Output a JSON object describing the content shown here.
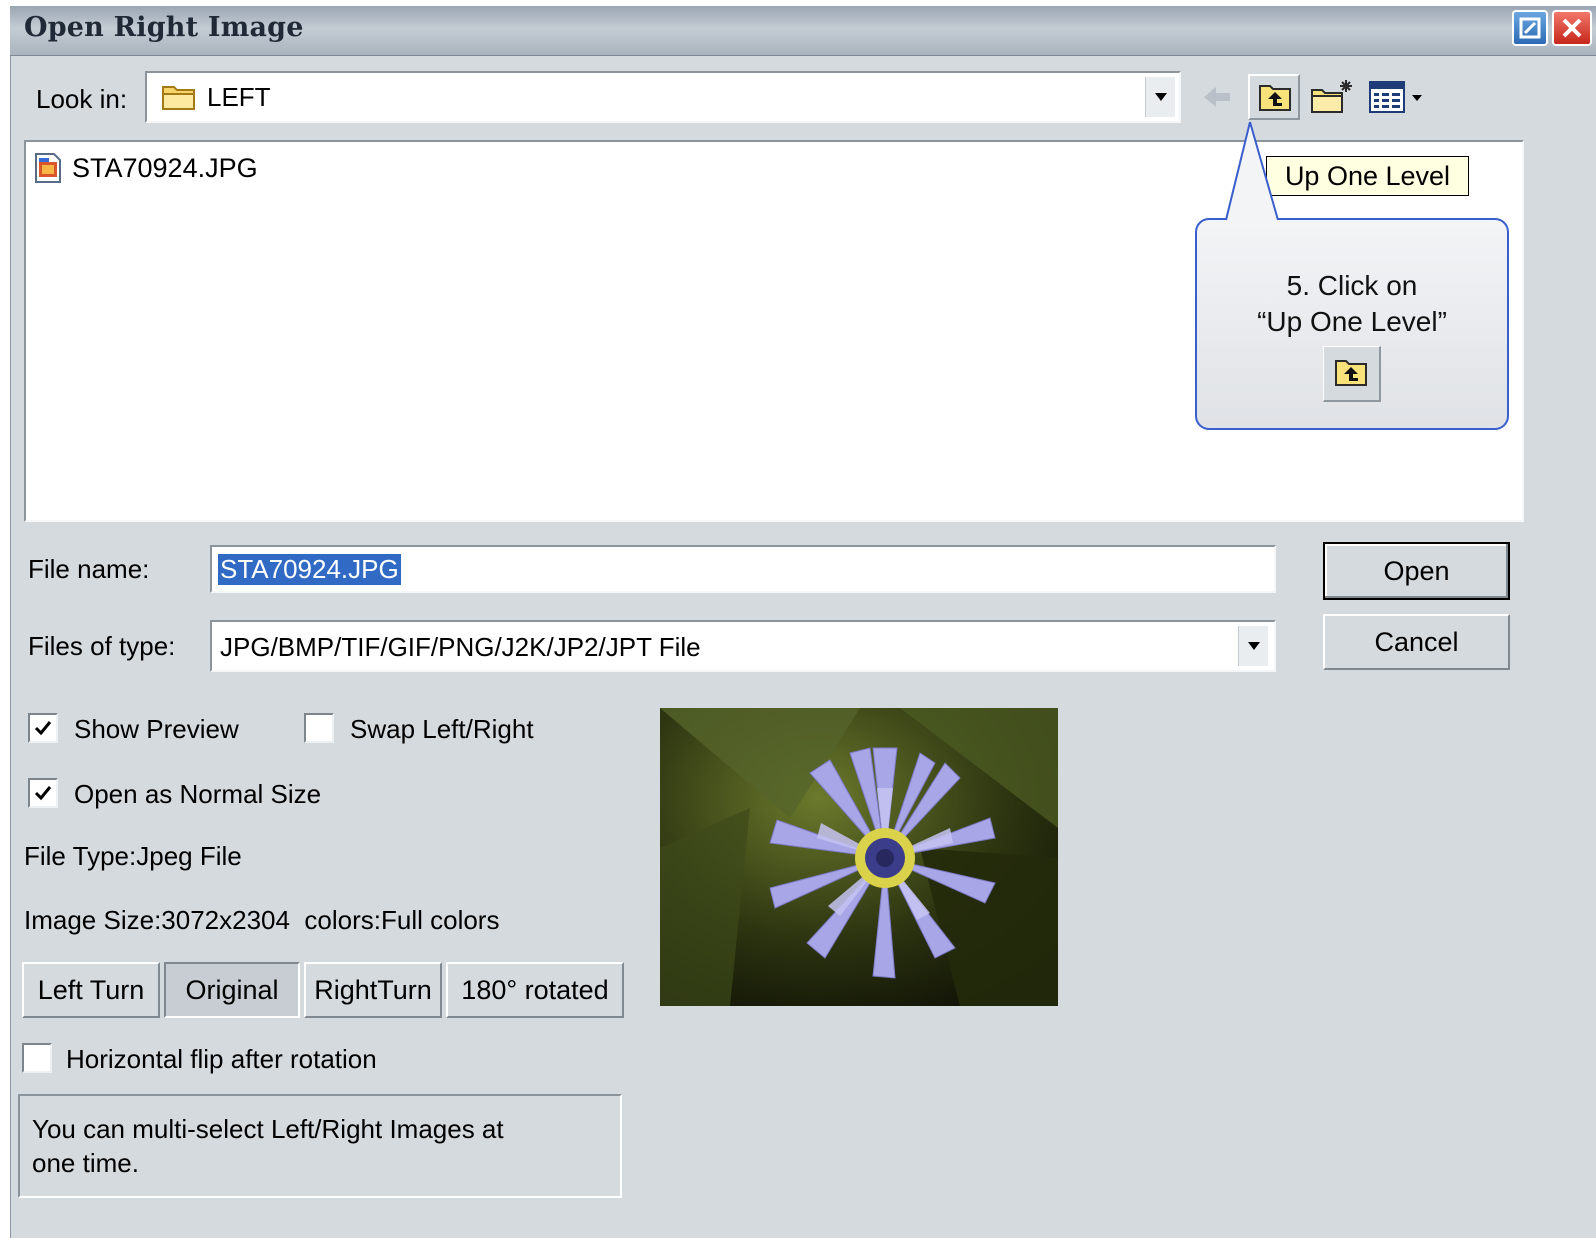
{
  "window": {
    "title": "Open Right Image"
  },
  "lookin": {
    "label": "Look in:",
    "value": "LEFT"
  },
  "toolbar": {
    "back": "back-icon",
    "up": "up-one-level-icon",
    "new_folder": "new-folder-icon",
    "view_menu": "view-menu-icon"
  },
  "tooltip": {
    "text": "Up One Level"
  },
  "callout": {
    "line1": "5. Click on",
    "line2": "“Up One Level”"
  },
  "files": [
    {
      "name": "STA70924.JPG",
      "icon": "jpg-file-icon"
    }
  ],
  "filename": {
    "label": "File name:",
    "value": "STA70924.JPG"
  },
  "filetype": {
    "label": "Files of type:",
    "value": "JPG/BMP/TIF/GIF/PNG/J2K/JP2/JPT File"
  },
  "buttons": {
    "open": "Open",
    "cancel": "Cancel"
  },
  "options": {
    "show_preview": {
      "label": "Show Preview",
      "checked": true
    },
    "swap": {
      "label": "Swap Left/Right",
      "checked": false
    },
    "normal_size": {
      "label": "Open as Normal Size",
      "checked": true
    },
    "hflip": {
      "label": "Horizontal flip after rotation",
      "checked": false
    }
  },
  "info": {
    "file_type": "File Type:Jpeg File",
    "image_size": "Image Size:3072x2304  colors:Full colors"
  },
  "rotation": {
    "left": "Left Turn",
    "original": "Original",
    "right": "RightTurn",
    "r180": "180° rotated",
    "selected": "Original"
  },
  "note": {
    "text": "You can multi-select Left/Right Images at one time."
  },
  "colors": {
    "callout_border": "#3a5fcd",
    "selection": "#316ac5"
  }
}
